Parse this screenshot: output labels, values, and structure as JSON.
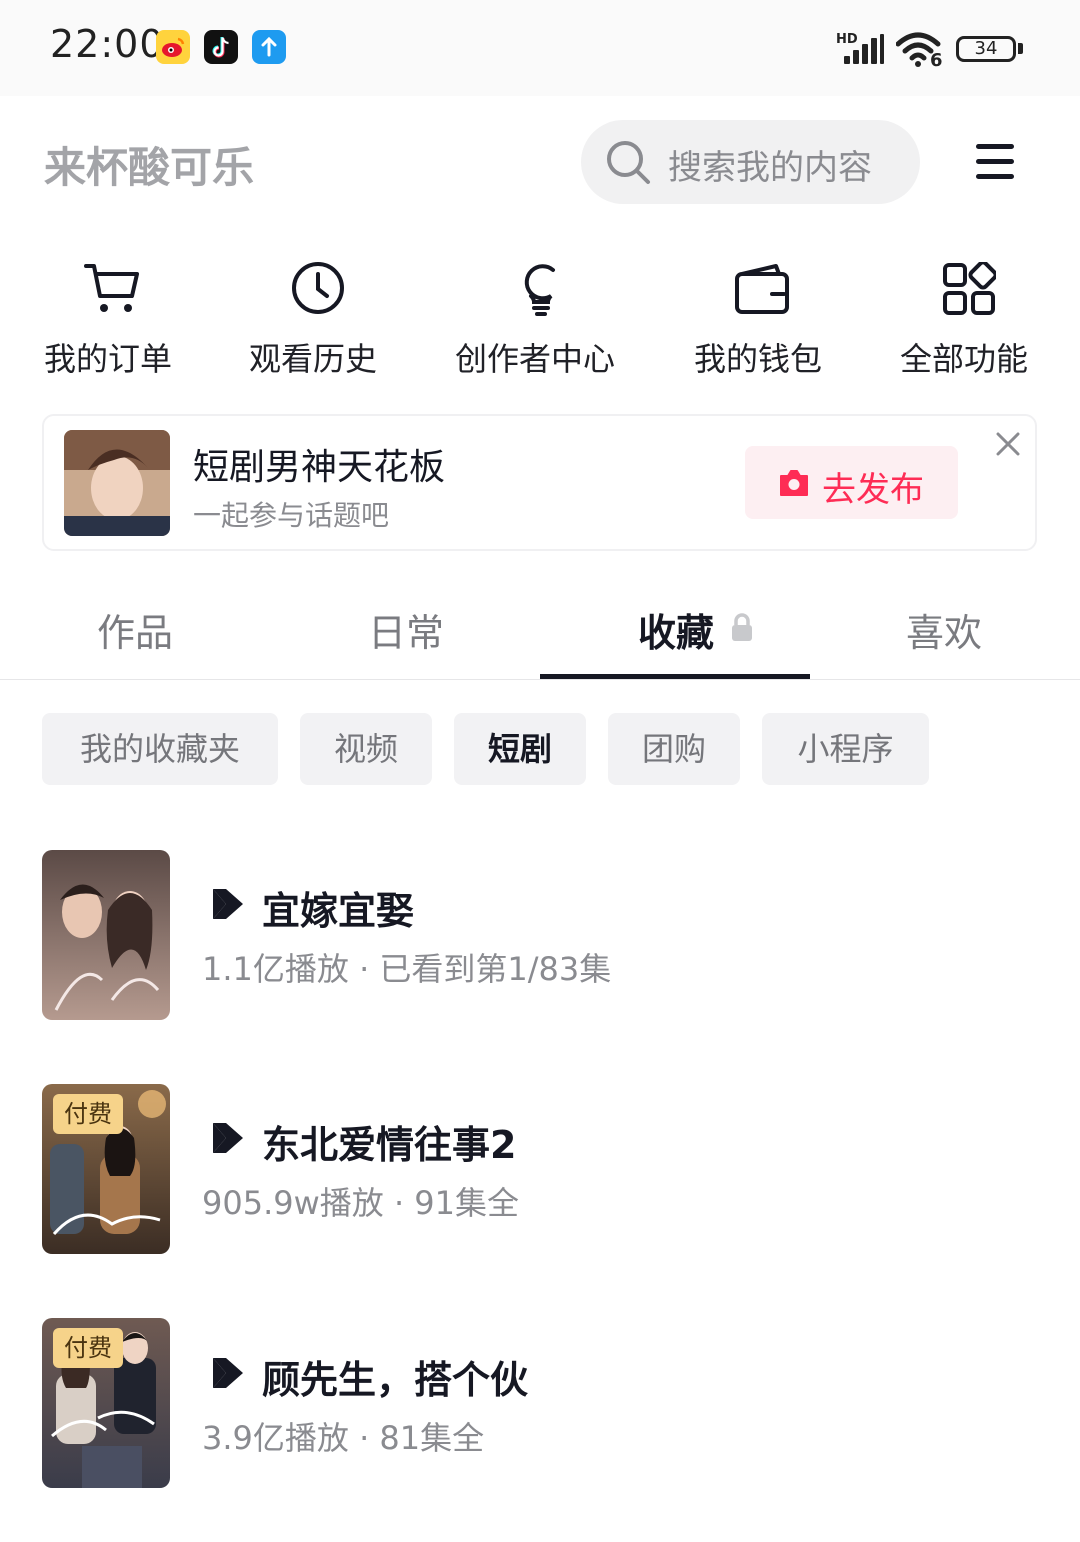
{
  "status_bar": {
    "time": "22:00",
    "network": "HD",
    "wifi_badge": "6",
    "battery": "34",
    "apps": [
      "weibo-icon",
      "tiktok-icon",
      "upload-arrow-icon"
    ]
  },
  "header": {
    "username": "来杯酸可乐",
    "search_placeholder": "搜索我的内容"
  },
  "quick_actions": [
    {
      "label": "我的订单",
      "icon": "cart-icon"
    },
    {
      "label": "观看历史",
      "icon": "clock-icon"
    },
    {
      "label": "创作者中心",
      "icon": "lightbulb-icon"
    },
    {
      "label": "我的钱包",
      "icon": "wallet-icon"
    },
    {
      "label": "全部功能",
      "icon": "grid-icon"
    }
  ],
  "banner": {
    "title": "短剧男神天花板",
    "subtitle": "一起参与话题吧",
    "button": "去发布"
  },
  "tabs": [
    "作品",
    "日常",
    "收藏",
    "喜欢"
  ],
  "active_tab": "收藏",
  "chips": [
    "我的收藏夹",
    "视频",
    "短剧",
    "团购",
    "小程序"
  ],
  "active_chip": "短剧",
  "dramas": [
    {
      "title": "宜嫁宜娶",
      "meta": "1.1亿播放 · 已看到第1/83集",
      "badge": ""
    },
    {
      "title": "东北爱情往事2",
      "meta": "905.9w播放 · 91集全",
      "badge": "付费"
    },
    {
      "title": "顾先生，搭个伙",
      "meta": "3.9亿播放 · 81集全",
      "badge": "付费"
    }
  ],
  "colors": {
    "accent": "#fe2c55",
    "text_primary": "#161823",
    "text_secondary": "#8a8b90",
    "chip_bg": "#f2f2f4",
    "paid_badge": "#f6d38a"
  }
}
